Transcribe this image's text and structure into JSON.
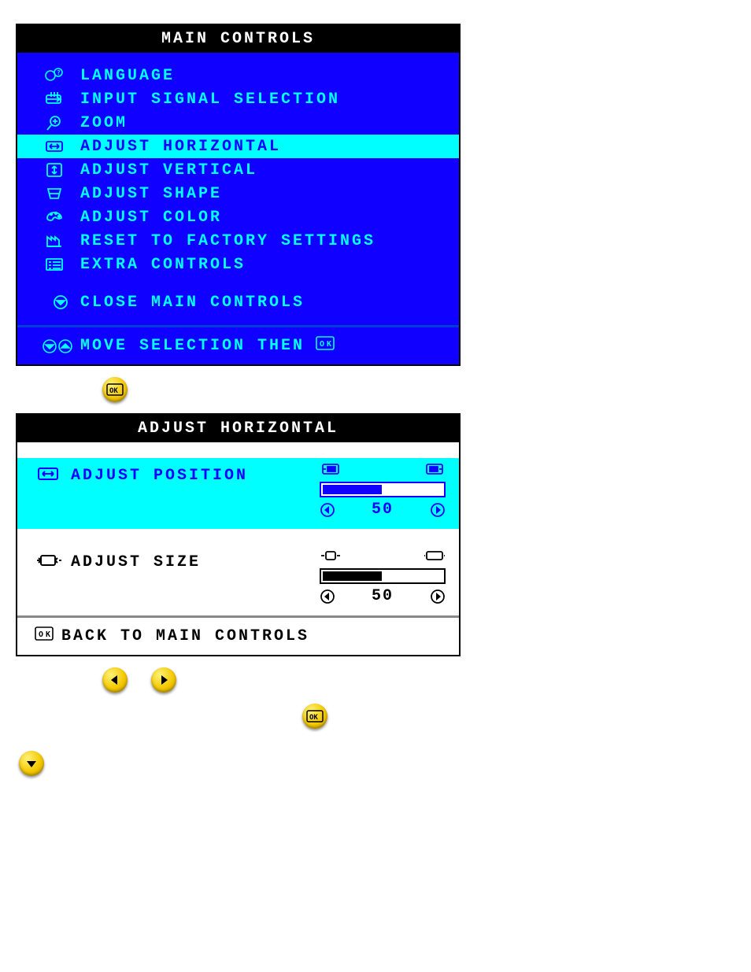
{
  "panel1": {
    "title": "MAIN CONTROLS",
    "items": [
      {
        "icon": "language-icon",
        "label": "LANGUAGE"
      },
      {
        "icon": "input-icon",
        "label": "INPUT SIGNAL SELECTION"
      },
      {
        "icon": "zoom-icon",
        "label": "ZOOM"
      },
      {
        "icon": "hadjust-icon",
        "label": "ADJUST HORIZONTAL",
        "selected": true
      },
      {
        "icon": "vadjust-icon",
        "label": "ADJUST VERTICAL"
      },
      {
        "icon": "shape-icon",
        "label": "ADJUST SHAPE"
      },
      {
        "icon": "color-icon",
        "label": "ADJUST COLOR"
      },
      {
        "icon": "factory-icon",
        "label": "RESET TO FACTORY SETTINGS"
      },
      {
        "icon": "extra-icon",
        "label": "EXTRA CONTROLS"
      }
    ],
    "close_label": "CLOSE MAIN CONTROLS",
    "footer_label": "MOVE SELECTION THEN"
  },
  "panel2": {
    "title": "ADJUST HORIZONTAL",
    "position": {
      "label": "ADJUST POSITION",
      "value": "50",
      "pct": 50
    },
    "size": {
      "label": "ADJUST SIZE",
      "value": "50",
      "pct": 50
    },
    "footer_label": "BACK TO MAIN CONTROLS"
  }
}
